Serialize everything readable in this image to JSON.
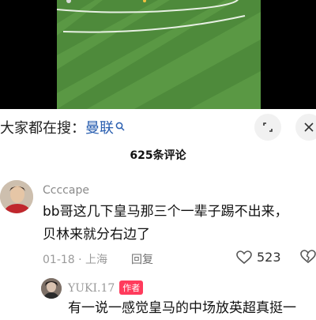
{
  "search": {
    "prefix": "大家都在搜：",
    "query": "曼联"
  },
  "comments_header": "625条评论",
  "comments": [
    {
      "username": "Ccccape",
      "text_line1": "bb哥这几下皇马那三个一辈子踢不出来，",
      "text_line2": "贝林来就分右边了",
      "date": "01-18",
      "location": "上海",
      "reply_label": "回复",
      "likes": "523"
    }
  ],
  "reply": {
    "username": "YUKI.17",
    "badge": "作者",
    "text": "有一说一感觉皇马的中场放英超真挺一"
  },
  "colors": {
    "pitch_light": "#5c9a46",
    "pitch_dark": "#4b873a",
    "link": "#2a5fb0",
    "author_badge": "#ff3b5c"
  }
}
